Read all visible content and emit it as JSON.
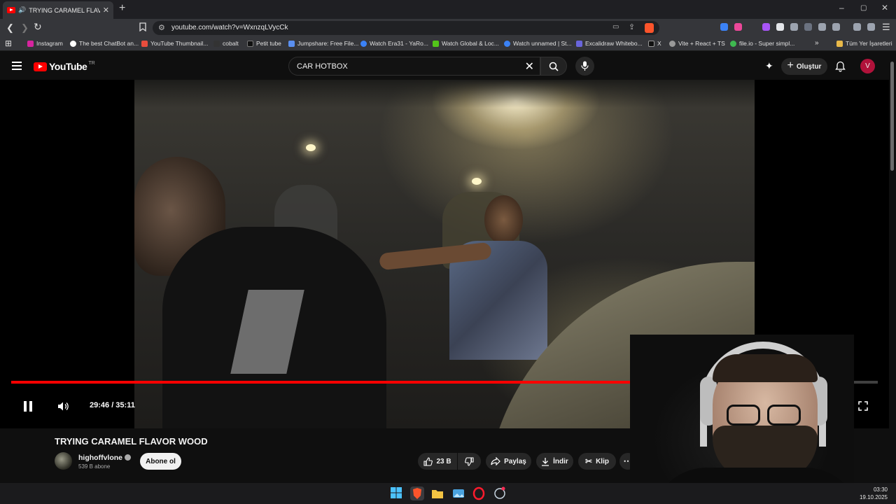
{
  "browser": {
    "tab_title": "TRYING CARAMEL FLAVOR W",
    "url": "youtube.com/watch?v=WxnzqLVycCk",
    "bookmarks": [
      {
        "label": "Instagram",
        "color": "#d6249f"
      },
      {
        "label": "The best ChatBot an...",
        "color": "#ffffff"
      },
      {
        "label": "YouTube Thumbnail...",
        "color": "#e84d3d"
      },
      {
        "label": "cobalt",
        "color": "#ffffff"
      },
      {
        "label": "Petit tube",
        "color": "#222222"
      },
      {
        "label": "Jumpshare: Free File...",
        "color": "#5a8ff0"
      },
      {
        "label": "Watch Era31 - YaRo...",
        "color": "#3b82f6"
      },
      {
        "label": "Watch Global & Loc...",
        "color": "#53c41a"
      },
      {
        "label": "Watch unnamed | St...",
        "color": "#3b82f6"
      },
      {
        "label": "Excalidraw Whitebo...",
        "color": "#6965db"
      },
      {
        "label": "X",
        "color": "#ffffff"
      },
      {
        "label": "Vite + React + TS",
        "color": "#999999"
      },
      {
        "label": "file.io - Super simpl...",
        "color": "#3fb950"
      }
    ],
    "all_bookmarks": "Tüm Yer İşaretleri"
  },
  "youtube": {
    "logo_text": "YouTube",
    "country": "TR",
    "search_query": "CAR HOTBOX",
    "create_label": "Oluştur",
    "avatar_letter": "V"
  },
  "player": {
    "time_current": "29:46",
    "time_total": "35:11",
    "time_display": "29:46 / 35:11",
    "progress_fraction": 0.846,
    "accent": "#ff0000"
  },
  "video": {
    "title": "TRYING CARAMEL FLAVOR WOOD",
    "channel": "highoffvlone",
    "subscribers": "539 B abone",
    "subscribe_label": "Abone ol",
    "likes": "23 B",
    "share_label": "Paylaş",
    "download_label": "İndir",
    "clip_label": "Klip"
  },
  "taskbar": {
    "time": "03:30",
    "date": "19.10.2025"
  }
}
